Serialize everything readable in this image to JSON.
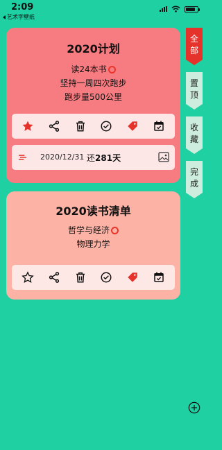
{
  "status_bar": {
    "time": "2:09",
    "back_app": "艺术字壁纸"
  },
  "cards": [
    {
      "title": "2020计划",
      "lines": [
        "读24本书",
        "坚持一周四次跑步",
        "跑步量500公里"
      ],
      "date": "2020/12/31",
      "remaining_prefix": "还",
      "remaining_days": "281",
      "remaining_suffix": "天"
    },
    {
      "title": "2020读书清单",
      "lines": [
        "哲学与经济",
        "物理力学"
      ]
    }
  ],
  "tabs": {
    "all": [
      "全",
      "部"
    ],
    "pin": [
      "置",
      "顶"
    ],
    "fav": [
      "收",
      "藏"
    ],
    "done": [
      "完",
      "成"
    ]
  },
  "colors": {
    "background": "#1fd1a2",
    "card1": "#f77c81",
    "card2": "#fcb3a6",
    "accent": "#e5322a",
    "tab_inactive": "#cdeede"
  },
  "icons": [
    "star-icon",
    "share-icon",
    "trash-icon",
    "check-circle-icon",
    "tag-icon",
    "calendar-icon",
    "weather-icon",
    "image-icon",
    "add-icon"
  ]
}
